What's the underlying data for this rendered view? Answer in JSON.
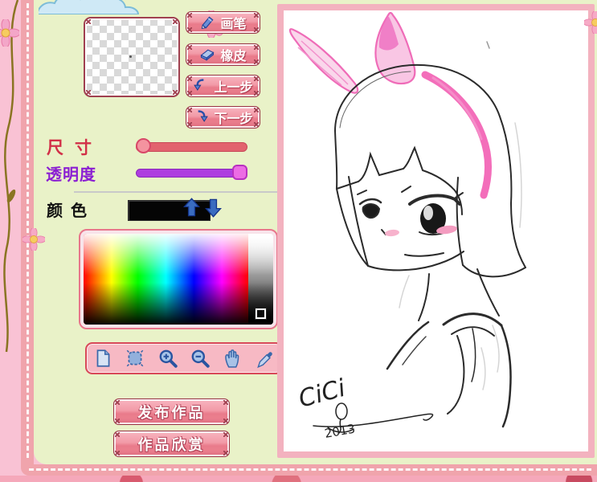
{
  "tool_buttons": [
    {
      "id": "brush",
      "label": "画笔",
      "icon": "pencil-icon"
    },
    {
      "id": "eraser",
      "label": "橡皮",
      "icon": "eraser-icon"
    },
    {
      "id": "undo",
      "label": "上一步",
      "icon": "undo-arrow-icon"
    },
    {
      "id": "redo",
      "label": "下一步",
      "icon": "redo-arrow-icon"
    }
  ],
  "sliders": {
    "size_label": "尺寸",
    "size_value_position": "minimum",
    "opacity_label": "透明度",
    "opacity_value_position": "maximum"
  },
  "color": {
    "label": "颜色",
    "current_value": "#000000"
  },
  "canvas_toolbar_icons": [
    "new-page",
    "select",
    "zoom-in",
    "zoom-out",
    "hand",
    "eyedropper"
  ],
  "actions": {
    "publish": "发布作品",
    "gallery": "作品欣赏"
  },
  "canvas": {
    "signature": "CiCi",
    "year": "2013",
    "content": "sketch of anime girl with bob haircut, pink bunny ears and pink hair streak"
  },
  "colors": {
    "page_background": "#f9c2d4",
    "panel_background": "#e9f2c8",
    "border_strip": "#f0a4ac",
    "canvas_frame": "#f3b2bf",
    "size_track": "#e2636e",
    "opacity_track": "#ae3ce0",
    "button_pink": "#ee8896",
    "accent_pink_ink": "#f266b6"
  }
}
